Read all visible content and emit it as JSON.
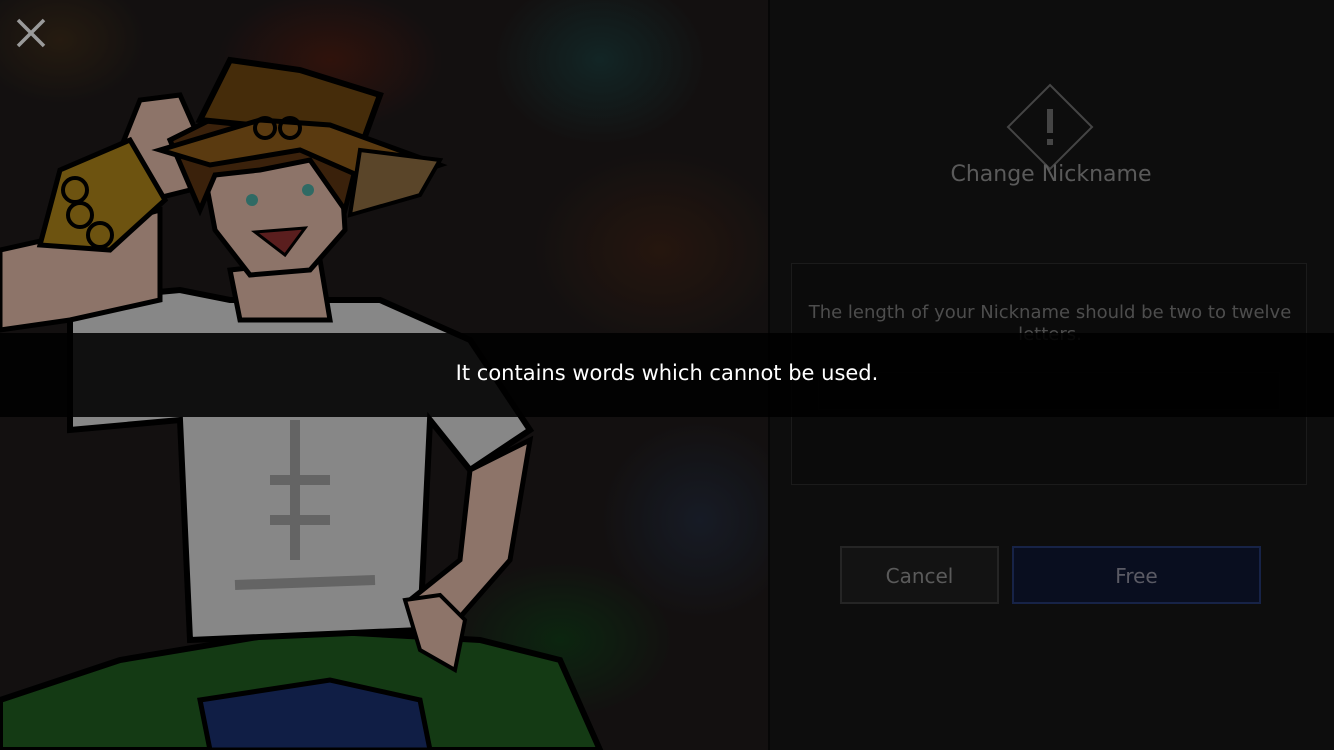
{
  "dialog": {
    "title": "Change Nickname",
    "rule_text": "The length of your Nickname should be two to twelve letters.",
    "input_value": "",
    "cancel_label": "Cancel",
    "confirm_label": "Free"
  },
  "toast": {
    "message": "It contains words which cannot be used."
  },
  "icons": {
    "close": "close-icon",
    "alert": "alert-diamond-icon"
  },
  "colors": {
    "confirm_border": "#24376d",
    "confirm_bg": "#0e1630",
    "toast_bg": "#000000"
  }
}
